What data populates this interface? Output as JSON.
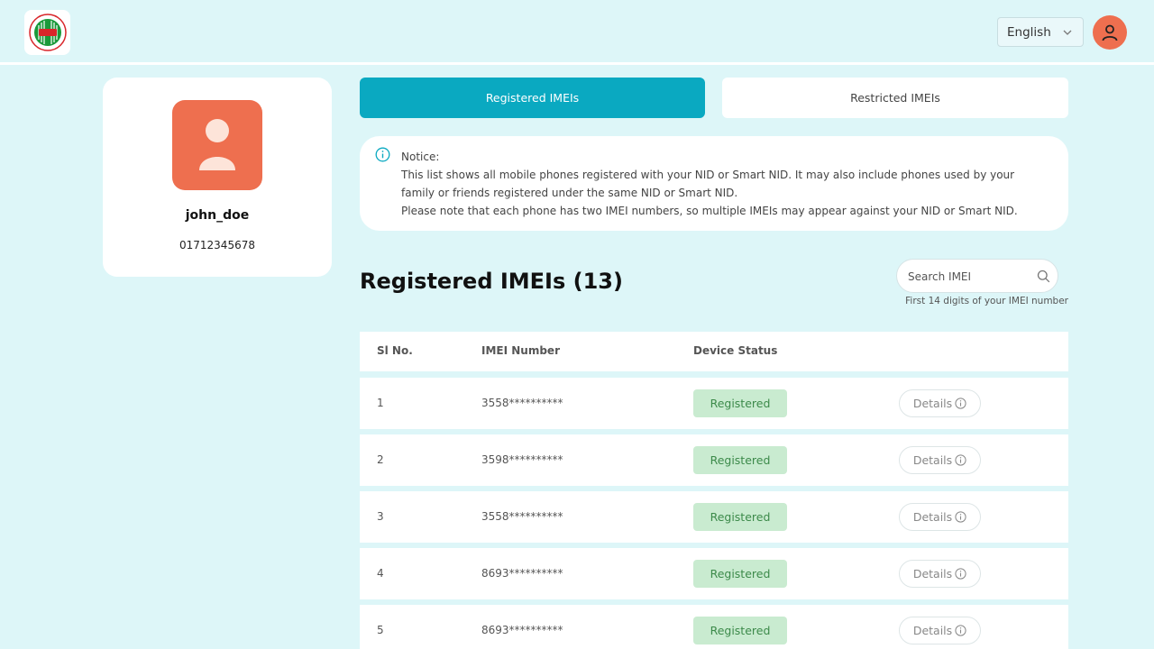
{
  "header": {
    "language": "English",
    "colors": {
      "background": "#ddf6f8",
      "avatar": "#ee6f4f"
    }
  },
  "profile": {
    "username": "john_doe",
    "phone": "01712345678"
  },
  "tabs": [
    {
      "label": "Registered IMEIs",
      "active": true
    },
    {
      "label": "Restricted IMEIs",
      "active": false
    }
  ],
  "notice": {
    "title": "Notice:",
    "lines": [
      "This list shows all mobile phones registered with your NID or Smart NID. It may also include phones used by your",
      "family or friends registered under the same NID or Smart NID.",
      "Please note that each phone has two IMEI numbers, so multiple IMEIs may appear against your NID or Smart NID."
    ]
  },
  "section": {
    "title": "Registered IMEIs (13)"
  },
  "search": {
    "placeholder": "Search IMEI",
    "hint": "First 14 digits of your IMEI number"
  },
  "table": {
    "headers": [
      "Sl No.",
      "IMEI Number",
      "Device Status"
    ],
    "details_label": "Details",
    "rows": [
      {
        "sl": "1",
        "imei": "3558**********",
        "status": "Registered"
      },
      {
        "sl": "2",
        "imei": "3598**********",
        "status": "Registered"
      },
      {
        "sl": "3",
        "imei": "3558**********",
        "status": "Registered"
      },
      {
        "sl": "4",
        "imei": "8693**********",
        "status": "Registered"
      },
      {
        "sl": "5",
        "imei": "8693**********",
        "status": "Registered"
      }
    ]
  },
  "icons": {
    "logo": "btrc-logo",
    "language_chevron": "chevron-down-icon",
    "account": "user-icon",
    "notice": "info-icon",
    "search": "search-icon",
    "details": "info-icon"
  }
}
